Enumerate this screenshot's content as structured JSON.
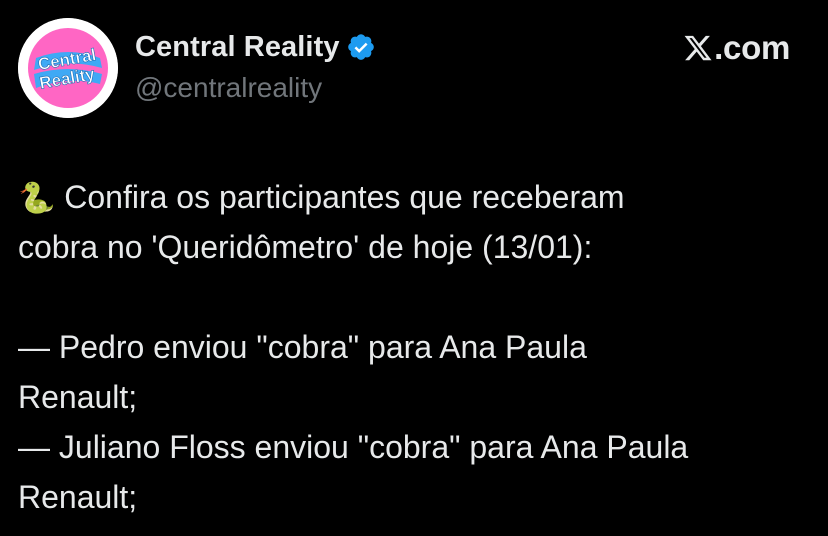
{
  "account": {
    "display_name": "Central Reality",
    "handle": "@centralreality",
    "verified": true,
    "avatar_text_line1": "Central",
    "avatar_text_line2": "Reality",
    "verified_icon": "verified-badge-icon",
    "verified_color": "#1d9bf0"
  },
  "brand": {
    "logo_icon": "x-logo-icon",
    "suffix": ".com"
  },
  "tweet": {
    "emoji": "🐍",
    "emoji_icon": "snake-emoji",
    "line1": " Confira os participantes que receberam",
    "line2": "cobra no 'Queridômetro' de hoje (13/01):",
    "line3": "— Pedro enviou \"cobra\" para Ana Paula",
    "line4": "Renault;",
    "line5": "— Juliano Floss enviou \"cobra\" para Ana Paula",
    "line6": "Renault;"
  },
  "colors": {
    "background": "#000000",
    "text_primary": "#e7e9ea",
    "text_secondary": "#71767b",
    "avatar_pink": "#ff66c4",
    "avatar_blue": "#3fa9f5"
  }
}
